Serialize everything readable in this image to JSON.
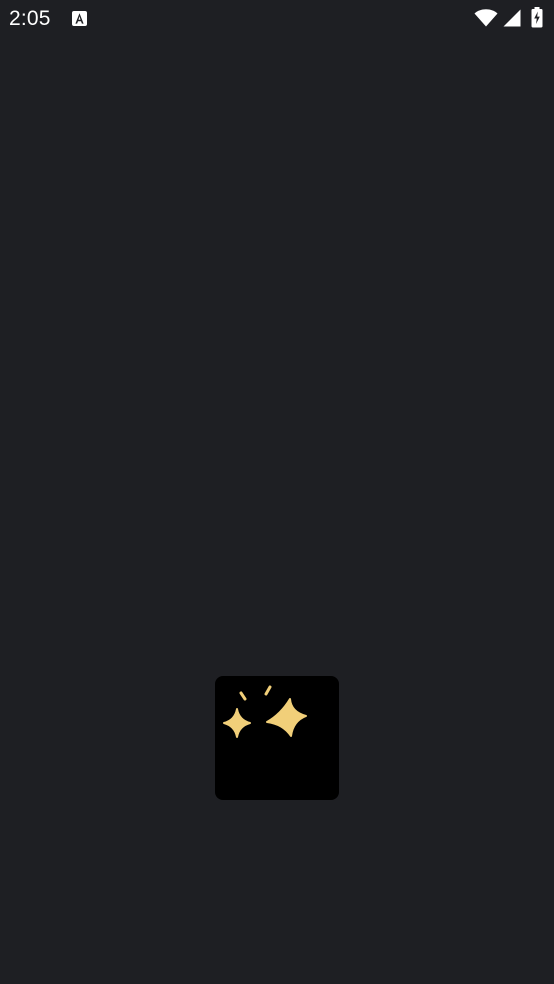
{
  "status_bar": {
    "time": "2:05",
    "icons": [
      "accessibility-icon",
      "wifi-icon",
      "signal-icon",
      "battery-charging-icon"
    ]
  },
  "splash": {
    "icon": "sparkles-icon",
    "card_color": "#000000",
    "sparkle_color": "#f1cf79"
  },
  "colors": {
    "background": "#1e1f23",
    "status_text": "#ffffff"
  }
}
